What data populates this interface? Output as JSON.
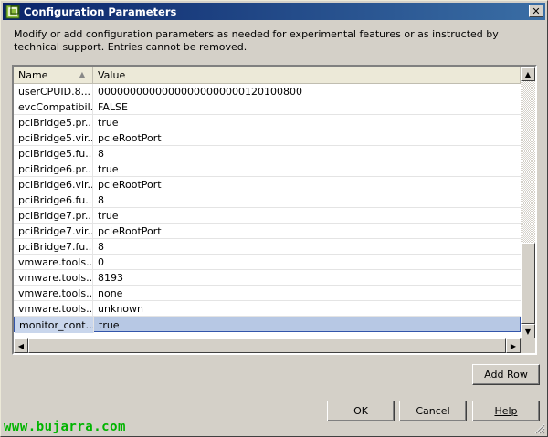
{
  "window": {
    "title": "Configuration Parameters",
    "close_label": "✕"
  },
  "description": "Modify or add configuration parameters as needed for experimental features or as instructed by technical support. Entries cannot be removed.",
  "table": {
    "columns": [
      "Name",
      "Value"
    ],
    "rows": [
      {
        "name": "userCPUID.8...",
        "value": "00000000000000000000000120100800"
      },
      {
        "name": "evcCompatibil...",
        "value": "FALSE"
      },
      {
        "name": "pciBridge5.pr...",
        "value": "true"
      },
      {
        "name": "pciBridge5.vir...",
        "value": "pcieRootPort"
      },
      {
        "name": "pciBridge5.fu...",
        "value": "8"
      },
      {
        "name": "pciBridge6.pr...",
        "value": "true"
      },
      {
        "name": "pciBridge6.vir...",
        "value": "pcieRootPort"
      },
      {
        "name": "pciBridge6.fu...",
        "value": "8"
      },
      {
        "name": "pciBridge7.pr...",
        "value": "true"
      },
      {
        "name": "pciBridge7.vir...",
        "value": "pcieRootPort"
      },
      {
        "name": "pciBridge7.fu...",
        "value": "8"
      },
      {
        "name": "vmware.tools....",
        "value": "0"
      },
      {
        "name": "vmware.tools....",
        "value": "8193"
      },
      {
        "name": "vmware.tools....",
        "value": "none"
      },
      {
        "name": "vmware.tools....",
        "value": "unknown"
      },
      {
        "name": "monitor_cont...",
        "value": "true"
      }
    ],
    "selected_index": 15
  },
  "buttons": {
    "add_row": "Add Row",
    "ok": "OK",
    "cancel": "Cancel",
    "help": "Help"
  },
  "watermark": "www.bujarra.com",
  "colors": {
    "title_start": "#0a246a",
    "title_end": "#3a6ea5",
    "selection": "#b7c8e4",
    "watermark": "#00b400"
  }
}
